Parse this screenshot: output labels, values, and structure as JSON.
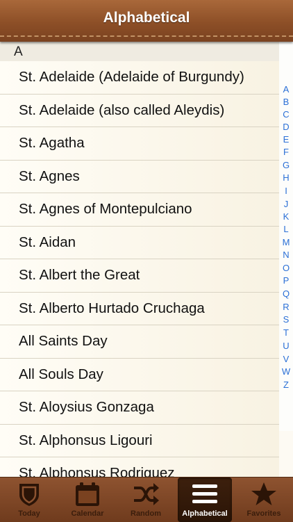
{
  "navbar": {
    "title": "Alphabetical"
  },
  "section": {
    "header": "A"
  },
  "saints": [
    "St. Adelaide (Adelaide of Burgundy)",
    "St. Adelaide (also called Aleydis)",
    "St. Agatha",
    "St. Agnes",
    "St. Agnes of Montepulciano",
    "St. Aidan",
    "St. Albert the Great",
    "St. Alberto Hurtado Cruchaga",
    "All Saints Day",
    "All Souls Day",
    "St. Aloysius Gonzaga",
    "St. Alphonsus Ligouri",
    "St. Alphonsus Rodriguez"
  ],
  "index_letters": [
    "A",
    "B",
    "C",
    "D",
    "E",
    "F",
    "G",
    "H",
    "I",
    "J",
    "K",
    "L",
    "M",
    "N",
    "O",
    "P",
    "Q",
    "R",
    "S",
    "T",
    "U",
    "V",
    "W",
    "Z"
  ],
  "tabs": [
    {
      "label": "Today",
      "icon": "shield-icon"
    },
    {
      "label": "Calendar",
      "icon": "calendar-icon"
    },
    {
      "label": "Random",
      "icon": "shuffle-icon"
    },
    {
      "label": "Alphabetical",
      "icon": "list-icon"
    },
    {
      "label": "Favorites",
      "icon": "star-icon"
    }
  ],
  "colors": {
    "navbar": "#8d4f27",
    "tabbar": "#7a4220",
    "index_accent": "#2a6fd6"
  },
  "active_tab": "Alphabetical"
}
